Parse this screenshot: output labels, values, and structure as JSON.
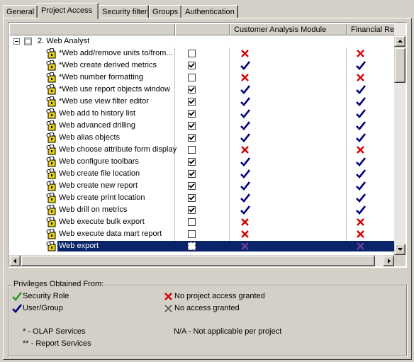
{
  "tabs": [
    {
      "label": "General",
      "active": false
    },
    {
      "label": "Project Access",
      "active": true
    },
    {
      "label": "Security filter",
      "active": false
    },
    {
      "label": "Groups",
      "active": false
    },
    {
      "label": "Authentication",
      "active": false
    }
  ],
  "grid": {
    "columns": [
      "",
      "",
      "Customer Analysis Module",
      "Financial Rep"
    ],
    "group_label": "2. Web Analyst",
    "rows": [
      {
        "label": "*Web add/remove units to/from...",
        "checked": false,
        "m1": "no_project",
        "m2": "no_project"
      },
      {
        "label": "*Web create derived metrics",
        "checked": true,
        "m1": "user_group",
        "m2": "user_group"
      },
      {
        "label": "*Web number formatting",
        "checked": false,
        "m1": "no_project",
        "m2": "no_project"
      },
      {
        "label": "*Web use report objects window",
        "checked": true,
        "m1": "user_group",
        "m2": "user_group"
      },
      {
        "label": "*Web use view filter editor",
        "checked": true,
        "m1": "user_group",
        "m2": "user_group"
      },
      {
        "label": "Web add to history list",
        "checked": true,
        "m1": "user_group",
        "m2": "user_group"
      },
      {
        "label": "Web advanced drilling",
        "checked": true,
        "m1": "user_group",
        "m2": "user_group"
      },
      {
        "label": "Web alias objects",
        "checked": true,
        "m1": "user_group",
        "m2": "user_group"
      },
      {
        "label": "Web choose attribute form display",
        "checked": false,
        "m1": "no_project",
        "m2": "no_project"
      },
      {
        "label": "Web configure toolbars",
        "checked": true,
        "m1": "user_group",
        "m2": "user_group"
      },
      {
        "label": "Web create file location",
        "checked": true,
        "m1": "user_group",
        "m2": "user_group"
      },
      {
        "label": "Web create new report",
        "checked": true,
        "m1": "user_group",
        "m2": "user_group"
      },
      {
        "label": "Web create print location",
        "checked": true,
        "m1": "user_group",
        "m2": "user_group"
      },
      {
        "label": "Web drill on metrics",
        "checked": true,
        "m1": "user_group",
        "m2": "user_group"
      },
      {
        "label": "Web execute bulk export",
        "checked": false,
        "m1": "no_project",
        "m2": "no_project"
      },
      {
        "label": "Web execute data mart report",
        "checked": false,
        "m1": "no_project",
        "m2": "no_project"
      },
      {
        "label": "Web export",
        "checked": false,
        "m1": "no_access",
        "m2": "no_access",
        "selected": true
      }
    ]
  },
  "legend": {
    "title": "Privileges Obtained From:",
    "security_role": "Security Role",
    "user_group": "User/Group",
    "no_project": "No project access granted",
    "no_access": "No access granted",
    "olap": "* - OLAP Services",
    "report_services": "** - Report Services",
    "na": "N/A - Not applicable per project"
  },
  "colors": {
    "check_green": "#2e9a2e",
    "check_blue": "#000080",
    "x_red": "#d40000",
    "x_purple": "#6b3f8f",
    "selection": "#0a246a"
  }
}
